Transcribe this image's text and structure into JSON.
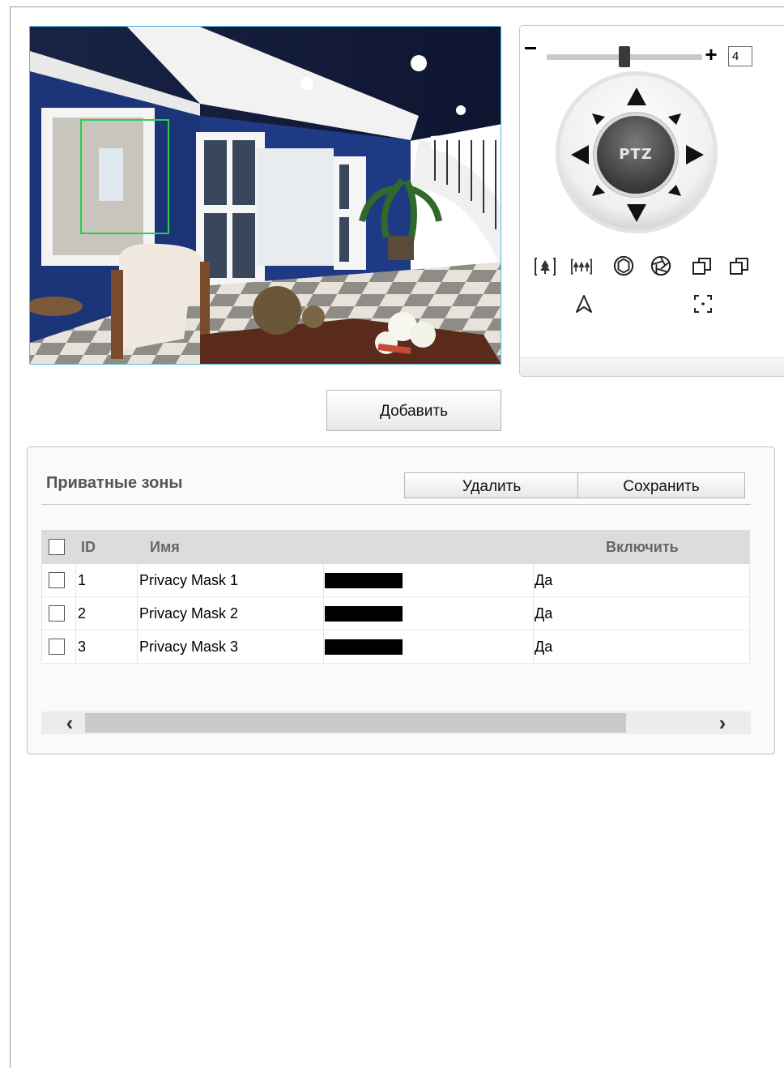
{
  "ptz": {
    "speed_value": "4",
    "button_label": "PTZ",
    "zoom_level_fraction": 0.5
  },
  "actions": {
    "add_label": "Добавить",
    "delete_label": "Удалить",
    "save_label": "Сохранить"
  },
  "panel": {
    "title": "Приватные зоны"
  },
  "table": {
    "headers": {
      "id": "ID",
      "name": "Имя",
      "enable": "Включить"
    },
    "rows": [
      {
        "id": "1",
        "name": "Privacy Mask 1",
        "enabled": "Да",
        "color": "#000000"
      },
      {
        "id": "2",
        "name": "Privacy Mask 2",
        "enabled": "Да",
        "color": "#000000"
      },
      {
        "id": "3",
        "name": "Privacy Mask 3",
        "enabled": "Да",
        "color": "#000000"
      }
    ]
  },
  "icons": {
    "zoom_in": "zoom-in-icon",
    "zoom_out": "zoom-out-icon",
    "iris_open": "iris-open-icon",
    "iris_close": "iris-close-icon",
    "focus_near": "focus-near-icon",
    "focus_far": "focus-far-icon",
    "auto": "auto-pan-icon",
    "center": "center-icon"
  },
  "colors": {
    "mask_rect": "#2ecc55",
    "video_border": "#5ab7e3"
  }
}
